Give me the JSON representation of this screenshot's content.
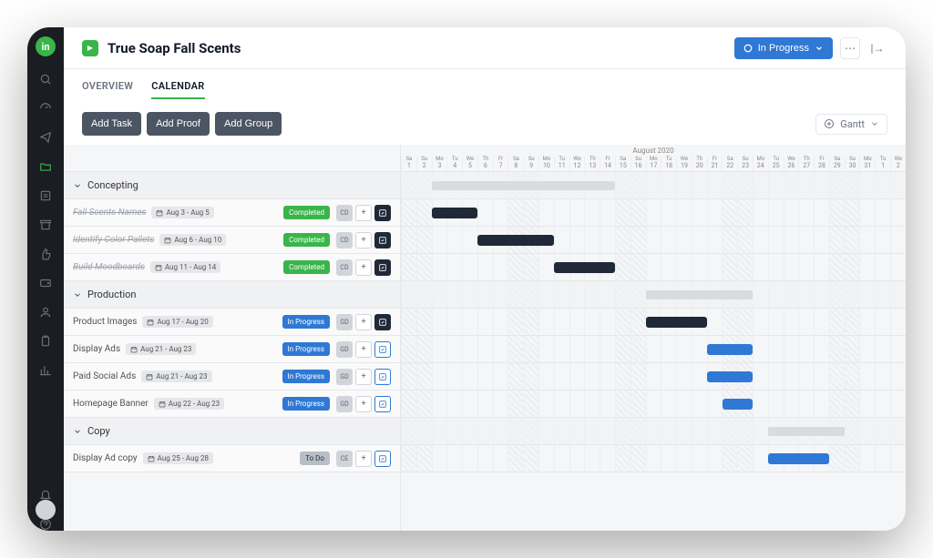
{
  "project": {
    "title": "True Soap Fall Scents"
  },
  "header": {
    "status_label": "In Progress"
  },
  "tabs": {
    "overview": "OVERVIEW",
    "calendar": "CALENDAR"
  },
  "toolbar": {
    "add_task": "Add Task",
    "add_proof": "Add Proof",
    "add_group": "Add Group",
    "view_label": "Gantt"
  },
  "gantt": {
    "month": "August 2020",
    "days": [
      {
        "dow": "Sa",
        "n": 1,
        "we": true
      },
      {
        "dow": "Su",
        "n": 2,
        "we": true
      },
      {
        "dow": "Mo",
        "n": 3
      },
      {
        "dow": "Tu",
        "n": 4
      },
      {
        "dow": "We",
        "n": 5
      },
      {
        "dow": "Th",
        "n": 6
      },
      {
        "dow": "Fr",
        "n": 7
      },
      {
        "dow": "Sa",
        "n": 8,
        "we": true
      },
      {
        "dow": "Su",
        "n": 9,
        "we": true
      },
      {
        "dow": "Mo",
        "n": 10
      },
      {
        "dow": "Tu",
        "n": 11
      },
      {
        "dow": "We",
        "n": 12
      },
      {
        "dow": "Th",
        "n": 13
      },
      {
        "dow": "Fr",
        "n": 14
      },
      {
        "dow": "Sa",
        "n": 15,
        "we": true
      },
      {
        "dow": "Su",
        "n": 16,
        "we": true
      },
      {
        "dow": "Mo",
        "n": 17
      },
      {
        "dow": "Tu",
        "n": 18
      },
      {
        "dow": "We",
        "n": 19
      },
      {
        "dow": "Th",
        "n": 20
      },
      {
        "dow": "Fr",
        "n": 21
      },
      {
        "dow": "Sa",
        "n": 22,
        "we": true
      },
      {
        "dow": "Su",
        "n": 23,
        "we": true
      },
      {
        "dow": "Mo",
        "n": 24
      },
      {
        "dow": "Tu",
        "n": 25
      },
      {
        "dow": "We",
        "n": 26
      },
      {
        "dow": "Th",
        "n": 27
      },
      {
        "dow": "Fr",
        "n": 28
      },
      {
        "dow": "Sa",
        "n": 29,
        "we": true
      },
      {
        "dow": "Su",
        "n": 30,
        "we": true
      },
      {
        "dow": "Mo",
        "n": 31
      },
      {
        "dow": "Tu",
        "n": 1
      },
      {
        "dow": "We",
        "n": 2
      }
    ],
    "groups": [
      {
        "name": "Concepting",
        "start": 2,
        "span": 12,
        "tasks": [
          {
            "name": "Fall Scents Names",
            "dates": "Aug 3 - Aug 5",
            "status": "Completed",
            "avatar": "CD",
            "start": 2,
            "span": 3,
            "done": true,
            "act": "dark"
          },
          {
            "name": "Identify Color Pallets",
            "dates": "Aug 6 - Aug 10",
            "status": "Completed",
            "avatar": "CD",
            "start": 5,
            "span": 5,
            "done": true,
            "act": "dark"
          },
          {
            "name": "Build Moodboards",
            "dates": "Aug 11 - Aug 14",
            "status": "Completed",
            "avatar": "CD",
            "start": 10,
            "span": 4,
            "done": true,
            "act": "dark"
          }
        ]
      },
      {
        "name": "Production",
        "start": 16,
        "span": 7,
        "tasks": [
          {
            "name": "Product Images",
            "dates": "Aug 17 - Aug 20",
            "status": "In Progress",
            "avatar": "GD",
            "start": 16,
            "span": 4,
            "done": true,
            "act": "dark"
          },
          {
            "name": "Display Ads",
            "dates": "Aug 21 - Aug 23",
            "status": "In Progress",
            "avatar": "GD",
            "start": 20,
            "span": 3,
            "act": "outline"
          },
          {
            "name": "Paid Social Ads",
            "dates": "Aug 21 - Aug 23",
            "status": "In Progress",
            "avatar": "GD",
            "start": 20,
            "span": 3,
            "act": "outline"
          },
          {
            "name": "Homepage Banner",
            "dates": "Aug 22 - Aug 23",
            "status": "In Progress",
            "avatar": "GD",
            "start": 21,
            "span": 2,
            "act": "outline"
          }
        ]
      },
      {
        "name": "Copy",
        "start": 24,
        "span": 5,
        "tasks": [
          {
            "name": "Display Ad copy",
            "dates": "Aug 25 - Aug 28",
            "status": "To Do",
            "avatar": "CE",
            "start": 24,
            "span": 4,
            "act": "outline"
          }
        ]
      }
    ]
  }
}
